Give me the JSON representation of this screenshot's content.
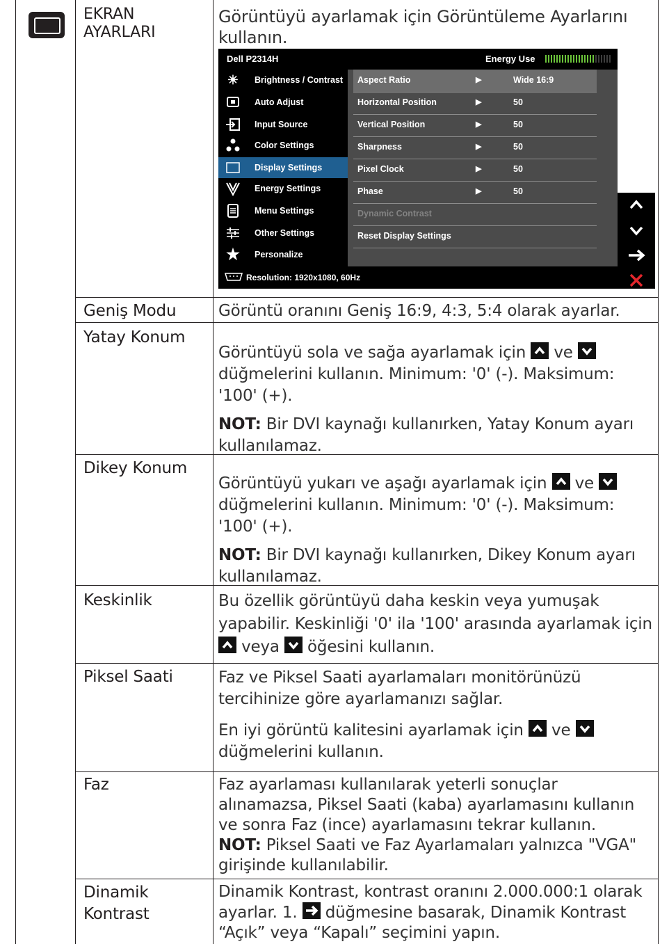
{
  "header": {
    "section_title_line1": "EKRAN",
    "section_title_line2": "AYARLARI",
    "intro_line1": "Görüntüyü ayarlamak için Görüntüleme Ayarlarını",
    "intro_line2": "kullanın.",
    "section_icon": "display-settings-icon"
  },
  "osd": {
    "model": "Dell P2314H",
    "energy_label": "Energy Use",
    "energy_level": 0.75,
    "menu": [
      {
        "label": "Brightness / Contrast",
        "icon": "brightness-icon"
      },
      {
        "label": "Auto Adjust",
        "icon": "auto-adjust-icon"
      },
      {
        "label": "Input Source",
        "icon": "input-source-icon"
      },
      {
        "label": "Color Settings",
        "icon": "color-settings-icon"
      },
      {
        "label": "Display Settings",
        "icon": "display-settings-icon",
        "selected": true
      },
      {
        "label": "Energy Settings",
        "icon": "energy-settings-icon"
      },
      {
        "label": "Menu Settings",
        "icon": "menu-settings-icon"
      },
      {
        "label": "Other Settings",
        "icon": "other-settings-icon"
      },
      {
        "label": "Personalize",
        "icon": "star-icon"
      }
    ],
    "settings": [
      {
        "label": "Aspect Ratio",
        "arrow": "▶",
        "value": "Wide 16:9"
      },
      {
        "label": "Horizontal Position",
        "arrow": "▶",
        "value": "50"
      },
      {
        "label": "Vertical Position",
        "arrow": "▶",
        "value": "50"
      },
      {
        "label": "Sharpness",
        "arrow": "▶",
        "value": "50"
      },
      {
        "label": "Pixel Clock",
        "arrow": "▶",
        "value": "50"
      },
      {
        "label": "Phase",
        "arrow": "▶",
        "value": "50"
      },
      {
        "label": "Dynamic Contrast",
        "arrow": "",
        "value": "",
        "disabled": true
      },
      {
        "label": "Reset Display Settings",
        "arrow": "",
        "value": ""
      }
    ],
    "resolution": "Resolution: 1920x1080, 60Hz",
    "side_buttons": [
      "up-arrow-icon",
      "down-arrow-icon",
      "right-arrow-icon",
      "close-icon"
    ]
  },
  "rows": {
    "genis": {
      "name": "Geniş Modu",
      "desc": "Görüntü oranını Geniş 16:9, 4:3, 5:4 olarak ayarlar."
    },
    "yatay": {
      "name": "Yatay Konum",
      "p1a": "Görüntüyü sola ve sağa ayarlamak için",
      "p1b": "ve",
      "p1c": "düğmelerini kullanın. Minimum: '0' (-). Maksimum: '100' (+).",
      "note_label": "NOT:",
      "note": "Bir DVI kaynağı kullanırken, Yatay Konum ayarı kullanılamaz."
    },
    "dikey": {
      "name": "Dikey Konum",
      "p1a": "Görüntüyü yukarı ve aşağı ayarlamak için",
      "p1b": "ve",
      "p1c": "düğmelerini kullanın. Minimum: '0' (-). Maksimum: '100' (+).",
      "note_label": "NOT:",
      "note": "Bir DVI kaynağı kullanırken, Dikey Konum ayarı kullanılamaz."
    },
    "keskinlik": {
      "name": "Keskinlik",
      "p1a": "Bu özellik görüntüyü daha keskin veya yumuşak yapabilir. Keskinliği '0' ila '100' arasında ayarlamak için",
      "p1b": "veya",
      "p1c": "öğesini kullanın."
    },
    "piksel": {
      "name": "Piksel Saati",
      "p1": "Faz ve Piksel Saati ayarlamaları monitörünüzü tercihinize göre ayarlamanızı sağlar.",
      "p2a": "En iyi görüntü kalitesini ayarlamak için",
      "p2b": "ve",
      "p2c": "düğmelerini kullanın."
    },
    "faz": {
      "name": "Faz",
      "p1": "Faz ayarlaması kullanılarak yeterli sonuçlar alınamazsa, Piksel Saati (kaba) ayarlamasını kullanın ve sonra Faz (ince) ayarlamasını tekrar kullanın.",
      "note_label": "NOT:",
      "note": "Piksel Saati ve Faz Ayarlamaları yalnızca \"VGA\" girişinde kullanılabilir."
    },
    "dinamik": {
      "name_line1": "Dinamik",
      "name_line2": "Kontrast",
      "p1a": "Dinamik Kontrast, kontrast oranını 2.000.000:1 olarak ayarlar. 1.",
      "p1b": "düğmesine basarak, Dinamik Kontrast “Açık” veya “Kapalı” seçimini yapın."
    }
  }
}
